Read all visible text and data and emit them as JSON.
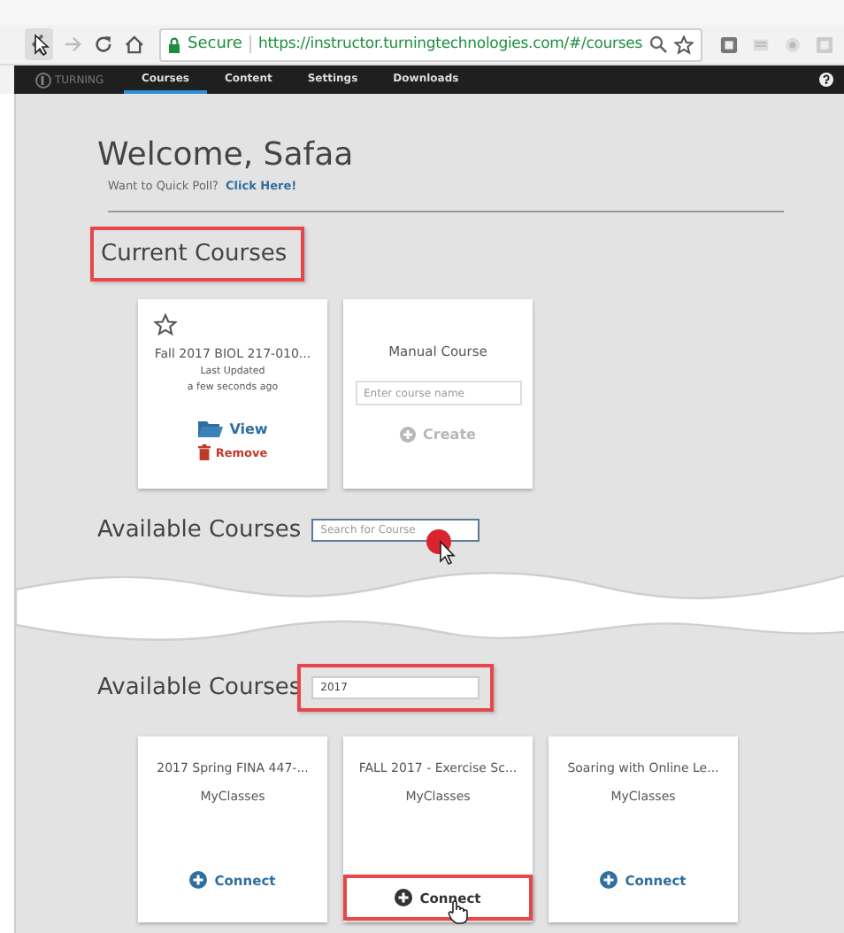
{
  "browser": {
    "secure_label": "Secure",
    "url": "https://instructor.turningtechnologies.com/#/courses"
  },
  "nav": {
    "logo": "TURNING",
    "items": [
      {
        "label": "Courses",
        "selected": true
      },
      {
        "label": "Content",
        "selected": false
      },
      {
        "label": "Settings",
        "selected": false
      },
      {
        "label": "Downloads",
        "selected": false
      }
    ]
  },
  "welcome": {
    "title": "Welcome, Safaa",
    "prompt": "Want to Quick Poll?",
    "link": "Click Here!"
  },
  "current_courses": {
    "heading": "Current Courses",
    "highlighted": true,
    "course": {
      "title": "Fall 2017 BIOL 217-010...",
      "starred": false,
      "updated_label": "Last Updated",
      "updated_time": "a few seconds ago",
      "view": "View",
      "remove": "Remove"
    },
    "manual": {
      "title": "Manual Course",
      "placeholder": "Enter course name",
      "create": "Create",
      "disabled": true
    }
  },
  "available_top": {
    "heading": "Available Courses",
    "placeholder": "Search for Course",
    "highlighted": false
  },
  "available_bottom": {
    "heading": "Available Courses",
    "search_value": "2017",
    "highlighted": true,
    "courses": [
      {
        "title": "2017 Spring FINA 447-...",
        "source": "MyClasses",
        "connect": "Connect",
        "highlighted": false
      },
      {
        "title": "FALL 2017 - Exercise Sc...",
        "source": "MyClasses",
        "connect": "Connect",
        "highlighted": true
      },
      {
        "title": "Soaring with Online Le...",
        "source": "MyClasses",
        "connect": "Connect",
        "highlighted": false
      }
    ]
  }
}
